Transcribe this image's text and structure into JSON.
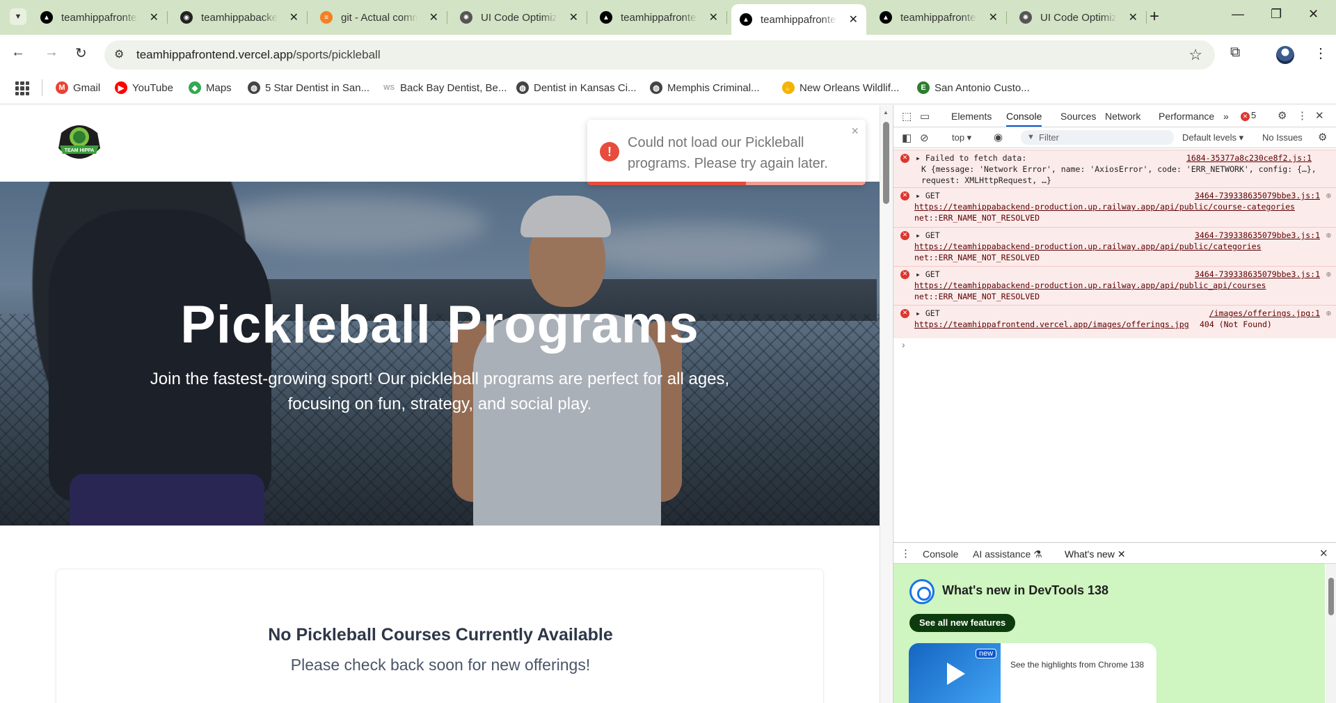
{
  "browser": {
    "tabs": [
      {
        "title": "teamhippafrontend",
        "favicon": "vercel"
      },
      {
        "title": "teamhippabackend",
        "favicon": "railway"
      },
      {
        "title": "git - Actual commit",
        "favicon": "stackoverflow"
      },
      {
        "title": "UI Code Optimization",
        "favicon": "chatgpt"
      },
      {
        "title": "teamhippafrontend",
        "favicon": "vercel"
      },
      {
        "title": "teamhippafrontend",
        "favicon": "vercel",
        "active": true
      },
      {
        "title": "teamhippafrontend",
        "favicon": "vercel"
      },
      {
        "title": "UI Code Optimization",
        "favicon": "chatgpt"
      }
    ],
    "close_glyph": "✕",
    "new_tab_glyph": "+",
    "url_host": "teamhippafrontend.vercel.app",
    "url_path": "/sports/pickleball",
    "bookmarks": [
      {
        "label": "Gmail",
        "icon": "gmail-icon"
      },
      {
        "label": "YouTube",
        "icon": "youtube-icon"
      },
      {
        "label": "Maps",
        "icon": "maps-icon"
      },
      {
        "label": "5 Star Dentist in San...",
        "icon": "globe-icon"
      },
      {
        "label": "Back Bay Dentist, Be...",
        "icon": "ws-icon",
        "icon_text": "WS"
      },
      {
        "label": "Dentist in Kansas Ci...",
        "icon": "globe-icon"
      },
      {
        "label": "Memphis Criminal...",
        "icon": "globe-icon"
      },
      {
        "label": "New Orleans Wildlif...",
        "icon": "hand-icon"
      },
      {
        "label": "San Antonio Custo...",
        "icon": "e-icon",
        "icon_text": "E"
      }
    ]
  },
  "page": {
    "hero_title": "Pickleball Programs",
    "hero_subtitle": "Join the fastest-growing sport! Our pickleball programs are perfect for all ages, focusing on fun, strategy, and social play.",
    "toast": {
      "message": "Could not load our Pickleball programs. Please try again later.",
      "icon_glyph": "!",
      "close_glyph": "×",
      "progress": 0.57
    },
    "empty_title": "No Pickleball Courses Currently Available",
    "empty_text": "Please check back soon for new offerings!",
    "logo_text": "TEAM HIPPA"
  },
  "devtools": {
    "tabs": [
      "Elements",
      "Console",
      "Sources",
      "Network",
      "Performance"
    ],
    "active_tab": "Console",
    "more_glyph": "»",
    "error_count": "5",
    "context": "top ▾",
    "filter_placeholder": "Filter",
    "levels": "Default levels ▾",
    "issues": "No Issues",
    "logs": [
      {
        "line1": "▸ Failed to fetch data:",
        "source": "1684-35377a8c230ce8f2.js:1",
        "object_text": "K {message: 'Network Error', name: 'AxiosError', code: 'ERR_NETWORK', config: {…}, request: XMLHttpRequest, …}"
      },
      {
        "line1": "▸ GET",
        "source": "3464-739338635079bbe3.js:1",
        "url": "https://teamhippabackend-production.up.railway.app/api/public/course-categories",
        "status": "net::ERR_NAME_NOT_RESOLVED"
      },
      {
        "line1": "▸ GET",
        "source": "3464-739338635079bbe3.js:1",
        "url": "https://teamhippabackend-production.up.railway.app/api/public/categories",
        "status": "net::ERR_NAME_NOT_RESOLVED"
      },
      {
        "line1": "▸ GET",
        "source": "3464-739338635079bbe3.js:1",
        "url": "https://teamhippabackend-production.up.railway.app/api/public_api/courses",
        "status": "net::ERR_NAME_NOT_RESOLVED"
      },
      {
        "line1": "▸ GET",
        "source": "/images/offerings.jpg:1",
        "url": "https://teamhippafrontend.vercel.app/images/offerings.jpg",
        "url_suffix": "404 (Not Found)"
      }
    ],
    "prompt_glyph": "›",
    "drawer": {
      "tabs": [
        "Console",
        "AI assistance",
        "What's new"
      ],
      "active_tab": "What's new",
      "whats_new_title": "What's new in DevTools 138",
      "see_all": "See all new features",
      "new_badge": "new",
      "highlight_text": "See the highlights from Chrome 138"
    }
  },
  "colors": {
    "error": "#dc362e",
    "tab_strip": "#d3e3c5",
    "accent": "#0b57d0"
  }
}
